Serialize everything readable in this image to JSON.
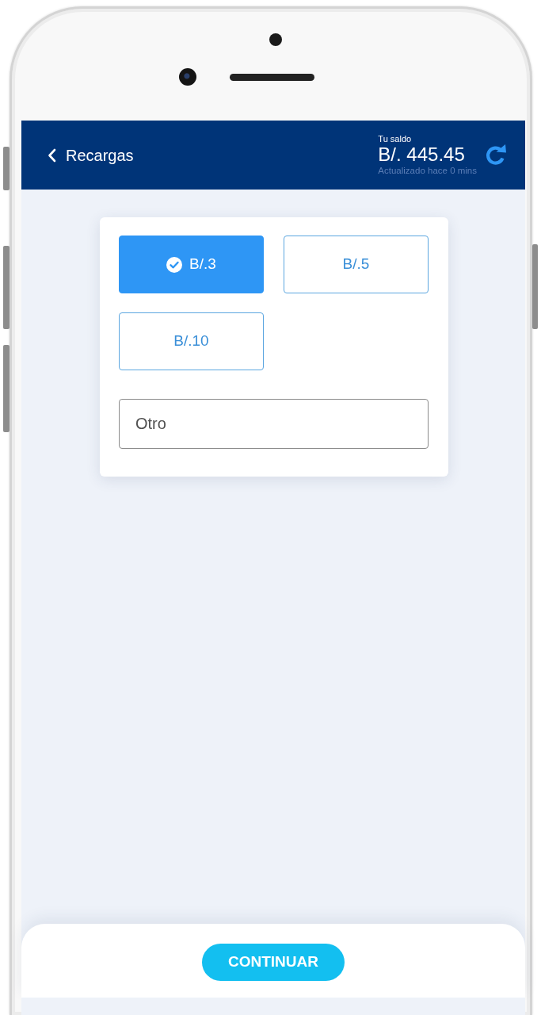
{
  "header": {
    "back_label": "Recargas",
    "balance_label": "Tu saldo",
    "balance": "B/. 445.45",
    "updated": "Actualizado hace 0 mins"
  },
  "amounts": [
    {
      "label": "B/.3",
      "selected": true
    },
    {
      "label": "B/.5",
      "selected": false
    },
    {
      "label": "B/.10",
      "selected": false
    }
  ],
  "other_amount": {
    "placeholder": "Otro"
  },
  "continue_button": {
    "label": "CONTINUAR"
  }
}
